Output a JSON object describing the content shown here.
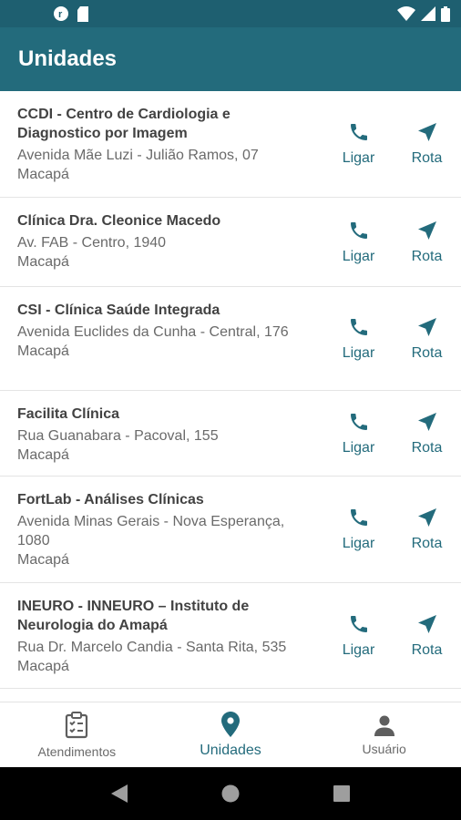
{
  "colors": {
    "primary": "#236b7c",
    "status_bar": "#1e5f70",
    "text_name": "#424242",
    "text_secondary": "#6a6a6a"
  },
  "status_bar": {
    "left_icons": [
      "app-notification-icon",
      "sd-card-icon"
    ],
    "right_icons": [
      "wifi-icon",
      "signal-icon",
      "battery-icon"
    ]
  },
  "header": {
    "title": "Unidades"
  },
  "actions": {
    "call_label": "Ligar",
    "route_label": "Rota",
    "call_icon": "phone-icon",
    "route_icon": "navigation-icon"
  },
  "units": [
    {
      "name": "CCDI - Centro de Cardiologia e Diagnostico por Imagem",
      "address": "Avenida Mãe Luzi - Julião Ramos, 07\nMacapá"
    },
    {
      "name": "Clínica Dra. Cleonice Macedo",
      "address": "Av. FAB - Centro, 1940\nMacapá"
    },
    {
      "name": "CSI - Clínica Saúde Integrada",
      "address": "Avenida Euclides da Cunha - Central, 176\nMacapá"
    },
    {
      "name": "Facilita Clínica",
      "address": "Rua Guanabara - Pacoval, 155\nMacapá"
    },
    {
      "name": "FortLab - Análises Clínicas",
      "address": "Avenida Minas Gerais - Nova Esperança, 1080\nMacapá"
    },
    {
      "name": "INEURO - INNEURO – Instituto de Neurologia do Amapá",
      "address": "Rua Dr. Marcelo Candia - Santa Rita, 535\nMacapá"
    }
  ],
  "bottom_nav": [
    {
      "label": "Atendimentos",
      "icon": "clipboard-icon",
      "active": false
    },
    {
      "label": "Unidades",
      "icon": "location-pin-icon",
      "active": true
    },
    {
      "label": "Usuário",
      "icon": "person-icon",
      "active": false
    }
  ],
  "system_nav": {
    "icons": [
      "back-icon",
      "home-icon",
      "recents-icon"
    ]
  }
}
